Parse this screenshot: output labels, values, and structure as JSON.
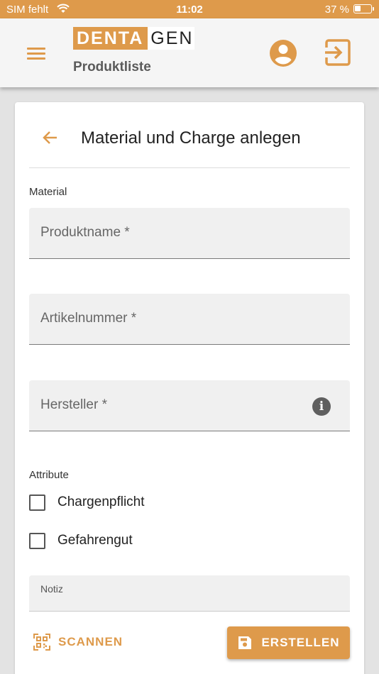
{
  "status_bar": {
    "carrier": "SIM fehlt",
    "time": "11:02",
    "battery": "37 %"
  },
  "app_bar": {
    "logo_left": "DENTA",
    "logo_right": "GEN",
    "subtitle": "Produktliste",
    "icons": [
      "menu-icon",
      "account-circle-icon",
      "logout-icon"
    ]
  },
  "form": {
    "title": "Material und Charge anlegen",
    "material_section": "Material",
    "fields": {
      "product_name": {
        "placeholder": "Produktname *",
        "value": ""
      },
      "article_number": {
        "placeholder": "Artikelnummer *",
        "value": ""
      },
      "manufacturer": {
        "placeholder": "Hersteller *",
        "value": ""
      }
    },
    "attributes_section": "Attribute",
    "checkboxes": [
      {
        "label": "Chargenpflicht",
        "checked": false
      },
      {
        "label": "Gefahrengut",
        "checked": false
      }
    ],
    "note_label": "Notiz"
  },
  "actions": {
    "scan": "SCANNEN",
    "create": "ERSTELLEN"
  },
  "colors": {
    "accent": "#de9a4b",
    "background": "#e3e3e3",
    "field_background": "#f0f0f0"
  }
}
